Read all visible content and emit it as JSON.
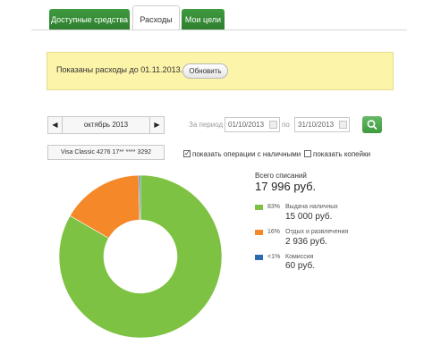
{
  "tabs": [
    {
      "label": "Доступные средства"
    },
    {
      "label": "Расходы"
    },
    {
      "label": "Мои цели"
    }
  ],
  "info": {
    "text": "Показаны расходы до 01.11.2013.",
    "refresh_button": "Обновить"
  },
  "filter": {
    "month": "октябрь 2013",
    "prev_icon": "◀",
    "next_icon": "▶",
    "period_label": "За период",
    "date_from": "01/10/2013",
    "to_label": "по",
    "date_to": "31/10/2013",
    "search_icon": "search-icon",
    "card": "Visa Classic 4276 17** **** 3292",
    "show_cash": {
      "label": "показать операции с наличными",
      "checked": true,
      "mark": "✓"
    },
    "show_kopecks": {
      "label": "показать копейки",
      "checked": false
    }
  },
  "summary": {
    "title": "Всего списаний",
    "total": "17 996 руб."
  },
  "chart_data": {
    "type": "pie",
    "donut": true,
    "series": [
      {
        "name": "Выдача наличных",
        "pct_label": "83%",
        "value_label": "15 000 руб.",
        "value": 15000,
        "color": "#7dc242"
      },
      {
        "name": "Отдых и развлечения",
        "pct_label": "16%",
        "value_label": "2 936 руб.",
        "value": 2936,
        "color": "#f5892a"
      },
      {
        "name": "Комиссия",
        "pct_label": "<1%",
        "value_label": "60 руб.",
        "value": 60,
        "color": "#2b6cb0"
      }
    ]
  }
}
